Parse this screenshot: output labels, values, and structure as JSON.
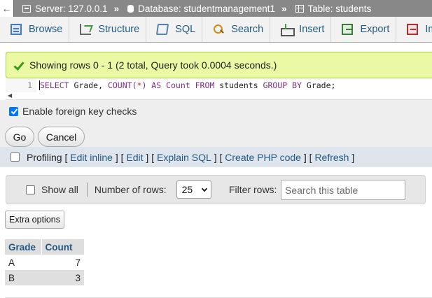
{
  "breadcrumb": {
    "back_icon": "←",
    "separator": "»",
    "server": "Server: 127.0.0.1",
    "database": "Database: studentmanagement1",
    "table": "Table: students"
  },
  "tabs": [
    {
      "label": "Browse",
      "icon": "browse-icon"
    },
    {
      "label": "Structure",
      "icon": "structure-icon"
    },
    {
      "label": "SQL",
      "icon": "sql-icon"
    },
    {
      "label": "Search",
      "icon": "search-icon"
    },
    {
      "label": "Insert",
      "icon": "insert-icon"
    },
    {
      "label": "Export",
      "icon": "export-icon"
    },
    {
      "label": "Impor",
      "icon": "import-icon"
    }
  ],
  "message": {
    "text": "Showing rows 0 - 1 (2 total, Query took 0.0004 seconds.)",
    "color": "#ebf8a4"
  },
  "sql": {
    "line_number": "1",
    "tokens": {
      "t1": "SELECT",
      "t2": " Grade, ",
      "t3": "COUNT",
      "t4": "(",
      "t5": "*",
      "t6": ")",
      "t7": " AS Count ",
      "t8": "FROM",
      "t9": " students ",
      "t10": "GROUP BY",
      "t11": " Grade;"
    }
  },
  "options": {
    "foreign_key_label": "Enable foreign key checks",
    "foreign_key_checked": true,
    "go_label": "Go",
    "cancel_label": "Cancel"
  },
  "profiling": {
    "label": "Profiling",
    "links": [
      "Edit inline",
      "Edit",
      "Explain SQL",
      "Create PHP code",
      "Refresh"
    ]
  },
  "navigation": {
    "show_all_label": "Show all",
    "rows_label": "Number of rows:",
    "rows_value": "25",
    "filter_label": "Filter rows:",
    "filter_placeholder": "Search this table"
  },
  "extra_options_label": "Extra options",
  "results": {
    "columns": [
      "Grade",
      "Count"
    ],
    "rows": [
      [
        "A",
        "7"
      ],
      [
        "B",
        "3"
      ]
    ]
  },
  "colors": {
    "link": "#235a81",
    "success_bg": "#ebf8a4",
    "header_bar": "#888888"
  }
}
